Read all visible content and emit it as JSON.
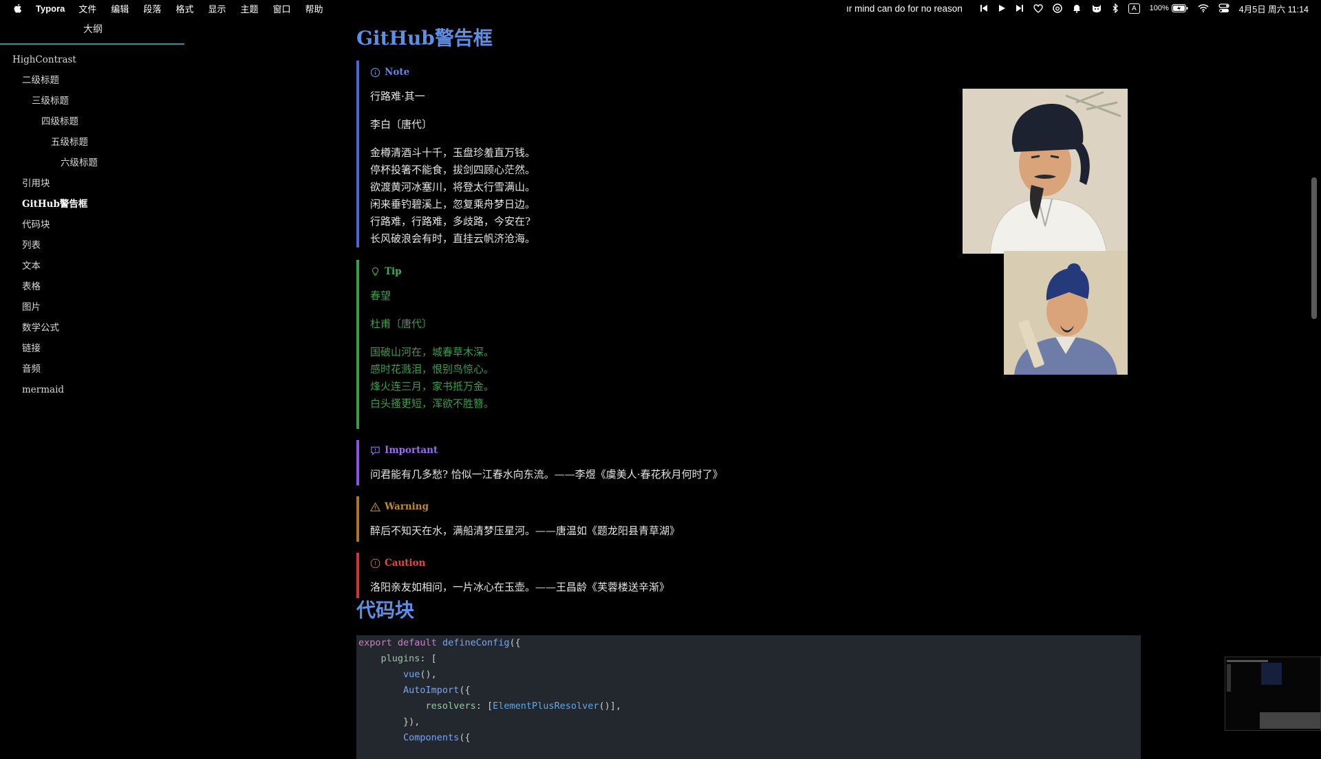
{
  "menubar": {
    "app_name": "Typora",
    "menus": [
      "文件",
      "编辑",
      "段落",
      "格式",
      "显示",
      "主题",
      "窗口",
      "帮助"
    ],
    "now_playing": "ır mind can do for no reason",
    "input_source": "A",
    "battery": "100%",
    "datetime": "4月5日 周六 11:14"
  },
  "sidebar": {
    "title": "大纲",
    "items": [
      {
        "label": "HighContrast",
        "level": 1
      },
      {
        "label": "二级标题",
        "level": 2
      },
      {
        "label": "三级标题",
        "level": 3
      },
      {
        "label": "四级标题",
        "level": 4
      },
      {
        "label": "五级标题",
        "level": 5
      },
      {
        "label": "六级标题",
        "level": 6
      },
      {
        "label": "引用块",
        "level": 2
      },
      {
        "label": "GitHub警告框",
        "level": 2,
        "active": true
      },
      {
        "label": "代码块",
        "level": 2
      },
      {
        "label": "列表",
        "level": 2
      },
      {
        "label": "文本",
        "level": 2
      },
      {
        "label": "表格",
        "level": 2
      },
      {
        "label": "图片",
        "level": 2
      },
      {
        "label": "数学公式",
        "level": 2
      },
      {
        "label": "链接",
        "level": 2
      },
      {
        "label": "音频",
        "level": 2
      },
      {
        "label": "mermaid",
        "level": 2
      }
    ]
  },
  "content": {
    "heading_alerts": "GitHub警告框",
    "note": {
      "label": "Note",
      "title": "行路难·其一",
      "author": "李白〔唐代〕",
      "lines": [
        "金樽清酒斗十千，玉盘珍羞直万钱。",
        "停杯投箸不能食，拔剑四顾心茫然。",
        "欲渡黄河冰塞川，将登太行雪满山。",
        "闲来垂钓碧溪上，忽复乘舟梦日边。",
        "行路难，行路难，多歧路，今安在?",
        "长风破浪会有时，直挂云帆济沧海。"
      ]
    },
    "tip": {
      "label": "Tip",
      "title": "春望",
      "author": "杜甫〔唐代〕",
      "lines": [
        "国破山河在，城春草木深。",
        "感时花溅泪，恨别鸟惊心。",
        "烽火连三月，家书抵万金。",
        "白头搔更短，浑欲不胜簪。"
      ]
    },
    "important": {
      "label": "Important",
      "text": "问君能有几多愁? 恰似一江春水向东流。——李煜《虞美人·春花秋月何时了》"
    },
    "warning": {
      "label": "Warning",
      "text": "醉后不知天在水，满船清梦压星河。——唐温如《题龙阳县青草湖》"
    },
    "caution": {
      "label": "Caution",
      "text": "洛阳亲友如相问，一片冰心在玉壶。——王昌龄《芙蓉楼送辛渐》"
    },
    "heading_code": "代码块",
    "code_lines": [
      [
        [
          "kw",
          "export"
        ],
        [
          "p",
          " "
        ],
        [
          "kw",
          "default"
        ],
        [
          "p",
          " "
        ],
        [
          "fn",
          "defineConfig"
        ],
        [
          "p",
          "({"
        ]
      ],
      [
        [
          "p",
          "    "
        ],
        [
          "pr",
          "plugins"
        ],
        [
          "p",
          ": ["
        ]
      ],
      [
        [
          "p",
          "        "
        ],
        [
          "fn",
          "vue"
        ],
        [
          "p",
          "(),"
        ]
      ],
      [
        [
          "p",
          "        "
        ],
        [
          "fn",
          "AutoImport"
        ],
        [
          "p",
          "({"
        ]
      ],
      [
        [
          "p",
          "            "
        ],
        [
          "pr",
          "resolvers"
        ],
        [
          "p",
          ": ["
        ],
        [
          "cl",
          "ElementPlusResolver"
        ],
        [
          "p",
          "()],"
        ]
      ],
      [
        [
          "p",
          "        }),"
        ]
      ],
      [
        [
          "p",
          "        "
        ],
        [
          "fn",
          "Components"
        ],
        [
          "p",
          "({"
        ]
      ]
    ]
  }
}
